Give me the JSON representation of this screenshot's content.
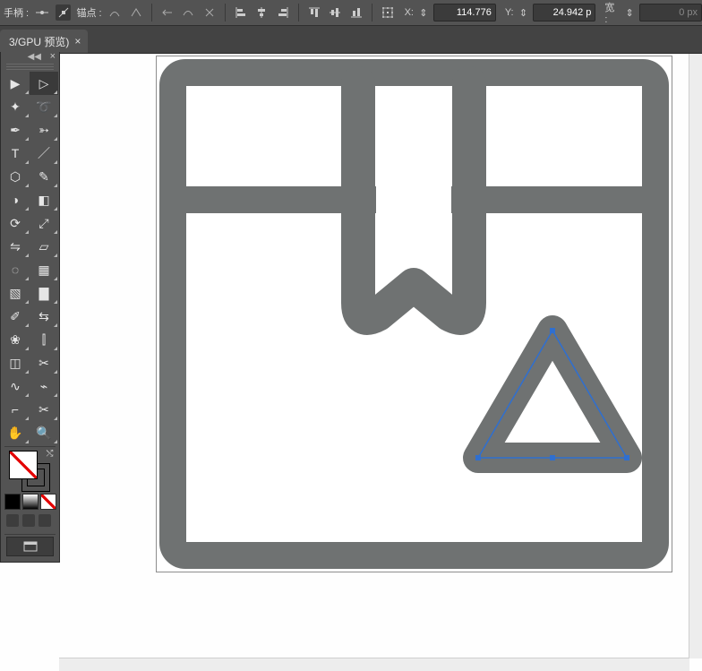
{
  "options_bar": {
    "handle_label": "手柄 :",
    "anchor_label": "锚点 :",
    "x_label": "X:",
    "y_label": "Y:",
    "w_label": "宽 :",
    "x_value": "114.776",
    "y_value": "24.942 p",
    "w_value": "0 px"
  },
  "tabs": {
    "active": {
      "title": "3/GPU 预览)",
      "close": "×"
    }
  },
  "tools_panel": {
    "collapse_glyph": "◀◀",
    "close_glyph": "×"
  },
  "tool_names": [
    [
      "selection",
      "direct-selection"
    ],
    [
      "magic-wand",
      "lasso"
    ],
    [
      "pen",
      "curvature"
    ],
    [
      "type",
      "line-segment"
    ],
    [
      "rectangle",
      "paintbrush"
    ],
    [
      "shape-builder",
      "eraser"
    ],
    [
      "rotate",
      "scale"
    ],
    [
      "width",
      "free-transform"
    ],
    [
      "shape-builder-2",
      "perspective"
    ],
    [
      "mesh",
      "gradient"
    ],
    [
      "eyedropper",
      "blend"
    ],
    [
      "symbol-sprayer",
      "column-graph"
    ],
    [
      "artboard",
      "slice"
    ],
    [
      "curve",
      "anchor"
    ],
    [
      "crop",
      "knife"
    ],
    [
      "hand",
      "zoom"
    ]
  ],
  "icon_glyphs": {
    "selection": "▶",
    "direct-selection": "▷",
    "magic-wand": "✦",
    "lasso": "➰",
    "pen": "✒",
    "curvature": "➳",
    "type": "T",
    "line-segment": "／",
    "rectangle": "⬡",
    "paintbrush": "✎",
    "shape-builder": "◑",
    "eraser": "◧",
    "rotate": "⟳",
    "scale": "⤢",
    "width": "⇋",
    "free-transform": "▱",
    "shape-builder-2": "◌",
    "perspective": "▦",
    "mesh": "▧",
    "gradient": "▇",
    "eyedropper": "✐",
    "blend": "⇆",
    "symbol-sprayer": "❀",
    "column-graph": "⫿",
    "artboard": "◫",
    "slice": "✂",
    "curve": "∿",
    "anchor": "⌁",
    "crop": "⌐",
    "knife": "✂",
    "hand": "✋",
    "zoom": "🔍"
  },
  "selected_tool": "direct-selection",
  "artwork": {
    "description": "package/box icon with bookmark flap and selected triangle shape",
    "selected_shape": "triangle",
    "selection_color": "#2f6fd0"
  }
}
